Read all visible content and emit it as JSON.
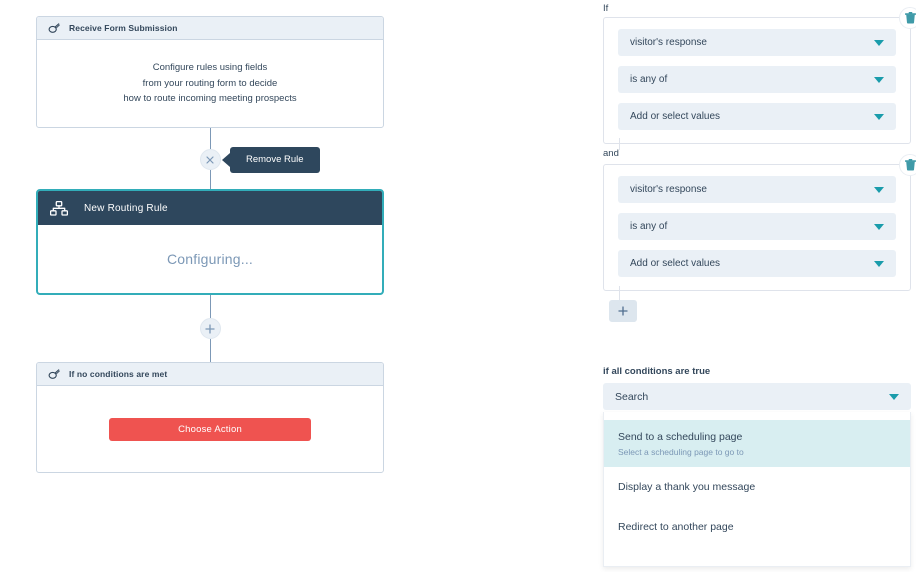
{
  "colors": {
    "accent_teal": "#32adb9",
    "dark_navy": "#2e475d",
    "header_bg": "#eaf0f6",
    "action_red": "#ef5350",
    "dropdown_highlight": "#d8eef1",
    "muted_text": "#7c98b6"
  },
  "flow": {
    "trigger_card": {
      "icon": "form-submission-icon",
      "title": "Receive Form Submission",
      "body_lines": [
        "Configure rules using fields",
        "from your routing form to decide",
        "how to route incoming meeting prospects"
      ]
    },
    "remove_node": {
      "icon": "close-x-icon",
      "tooltip": "Remove Rule"
    },
    "rule_card": {
      "icon": "sitemap-icon",
      "title": "New Routing Rule",
      "status": "Configuring..."
    },
    "add_node": {
      "icon": "plus-icon",
      "label": "+"
    },
    "fallback_card": {
      "icon": "form-submission-icon",
      "title": "If no conditions are met",
      "action_label": "Choose Action"
    }
  },
  "panel": {
    "if_label": "If",
    "and_label": "and",
    "condition_groups": [
      {
        "delete_icon": "trash-icon",
        "fields": [
          {
            "value": "visitor's response",
            "icon": "chevron-down-icon"
          },
          {
            "value": "is any of",
            "icon": "chevron-down-icon"
          },
          {
            "value": "Add or select values",
            "icon": "chevron-down-icon"
          }
        ]
      },
      {
        "delete_icon": "trash-icon",
        "fields": [
          {
            "value": "visitor's response",
            "icon": "chevron-down-icon"
          },
          {
            "value": "is any of",
            "icon": "chevron-down-icon"
          },
          {
            "value": "Add or select values",
            "icon": "chevron-down-icon"
          }
        ]
      }
    ],
    "add_condition": {
      "icon": "plus-icon",
      "label": "+"
    },
    "outcome": {
      "label": "if all conditions are true",
      "search": {
        "value": "Search",
        "placeholder": "Search",
        "icon": "chevron-down-icon"
      },
      "options": [
        {
          "title": "Send to a scheduling page",
          "subtitle": "Select a scheduling page to go to",
          "selected": true
        },
        {
          "title": "Display a thank you message",
          "subtitle": "",
          "selected": false
        },
        {
          "title": "Redirect to another page",
          "subtitle": "",
          "selected": false
        }
      ]
    }
  }
}
